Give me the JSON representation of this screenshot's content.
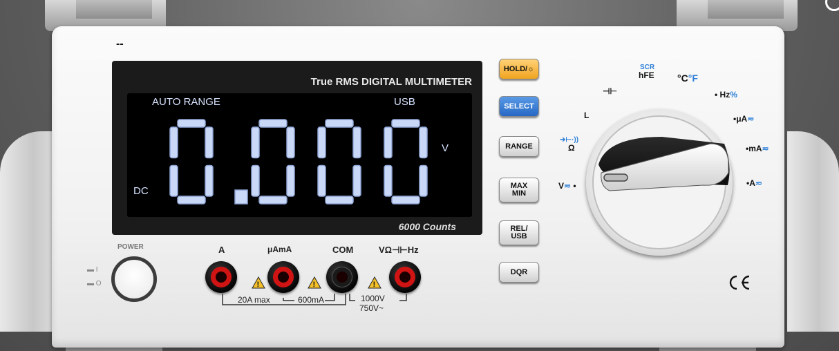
{
  "status_text": "--",
  "display": {
    "title": "True RMS  DIGITAL MULTIMETER",
    "auto_range": "AUTO RANGE",
    "usb": "USB",
    "unit": "V",
    "mode": "DC",
    "reading": "0.000",
    "counts": "6000  Counts"
  },
  "buttons": {
    "hold": "HOLD/☼",
    "select": "SELECT",
    "range": "RANGE",
    "max_min_1": "MAX",
    "max_min_2": "MIN",
    "rel_usb_1": "REL/",
    "rel_usb_2": "USB",
    "dqr": "DQR"
  },
  "dial": {
    "positions": {
      "scr": "SCR",
      "hfe": "hFE",
      "temp": "°C",
      "temp_f": "°F",
      "cap": "⊣⊢",
      "hz": "Hz",
      "pct": "%",
      "ua": "μA",
      "ma": "mA",
      "a": "A",
      "l": "L",
      "diode": "➔⊢·))",
      "ohm": "Ω",
      "v": "V",
      "ac_dc": "≂"
    },
    "selected": "V"
  },
  "terminals": {
    "a": "A",
    "uama": "μAmA",
    "com": "COM",
    "vohm": "VΩ⊣⊢Hz",
    "limit_a": "20A max",
    "limit_ma": "600mA",
    "limit_v1": "1000V",
    "limit_v2": "750V~"
  },
  "power": {
    "label": "POWER",
    "on": "▬ I",
    "off": "▬ O"
  },
  "ce_mark": "CE",
  "colors": {
    "lcd_digits": "#c9d8f7",
    "hold_button": "#f3b23a",
    "select_button": "#3b82d6",
    "jack_red": "#d01414"
  }
}
